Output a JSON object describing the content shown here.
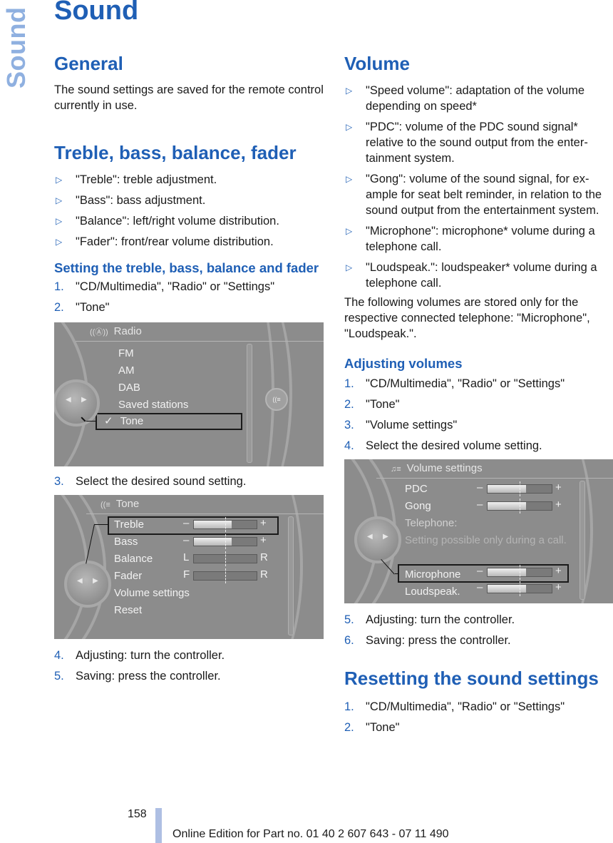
{
  "side_tab": "Sound",
  "page_title": "Sound",
  "left": {
    "general": {
      "heading": "General",
      "text": "The sound settings are saved for the remote control currently in use."
    },
    "treble": {
      "heading": "Treble, bass, balance, fader",
      "bullets": [
        "\"Treble\": treble adjustment.",
        "\"Bass\": bass adjustment.",
        "\"Balance\": left/right volume distribution.",
        "\"Fader\": front/rear volume distribution."
      ]
    },
    "setting": {
      "heading": "Setting the treble, bass, balance and fader",
      "steps_a": [
        {
          "num": "1.",
          "text": "\"CD/Multimedia\", \"Radio\" or \"Settings\""
        },
        {
          "num": "2.",
          "text": "\"Tone\""
        }
      ],
      "step_3": {
        "num": "3.",
        "text": "Select the desired sound setting."
      },
      "steps_b": [
        {
          "num": "4.",
          "text": "Adjusting: turn the controller."
        },
        {
          "num": "5.",
          "text": "Saving: press the controller."
        }
      ]
    }
  },
  "radio_screen": {
    "title": "Radio",
    "items": [
      "FM",
      "AM",
      "DAB",
      "Saved stations",
      "Tone"
    ],
    "selected": "Tone",
    "check": "✓"
  },
  "tone_screen": {
    "title": "Tone",
    "rows": [
      {
        "label": "Treble",
        "left": "–",
        "right": "+",
        "value": 0.6
      },
      {
        "label": "Bass",
        "left": "–",
        "right": "+",
        "value": 0.6
      },
      {
        "label": "Balance",
        "left": "L",
        "right": "R",
        "value": 0.5
      },
      {
        "label": "Fader",
        "left": "F",
        "right": "R",
        "value": 0.5
      }
    ],
    "extra_items": [
      "Volume settings",
      "Reset"
    ],
    "selected": "Treble"
  },
  "right": {
    "volume": {
      "heading": "Volume",
      "bullets": [
        "\"Speed volume\": adaptation of the volume depending on speed*",
        "\"PDC\": volume of the PDC sound signal* relative to the sound output from the enter-tainment system.",
        "\"Gong\": volume of the sound signal, for ex-ample for seat belt reminder, in relation to the sound output from the entertainment system.",
        "\"Microphone\": microphone* volume during a telephone call.",
        "\"Loudspeak.\": loudspeaker* volume during a telephone call."
      ],
      "note": "The following volumes are stored only for the respective connected telephone: \"Microphone\", \"Loudspeak.\"."
    },
    "adjusting": {
      "heading": "Adjusting volumes",
      "steps_a": [
        {
          "num": "1.",
          "text": "\"CD/Multimedia\", \"Radio\" or \"Settings\""
        },
        {
          "num": "2.",
          "text": "\"Tone\""
        },
        {
          "num": "3.",
          "text": "\"Volume settings\""
        },
        {
          "num": "4.",
          "text": "Select the desired volume setting."
        }
      ],
      "steps_b": [
        {
          "num": "5.",
          "text": "Adjusting: turn the controller."
        },
        {
          "num": "6.",
          "text": "Saving: press the controller."
        }
      ]
    },
    "resetting": {
      "heading": "Resetting the sound settings",
      "steps": [
        {
          "num": "1.",
          "text": "\"CD/Multimedia\", \"Radio\" or \"Settings\""
        },
        {
          "num": "2.",
          "text": "\"Tone\""
        }
      ]
    }
  },
  "volume_screen": {
    "title": "Volume settings",
    "rows": [
      {
        "label": "PDC",
        "value": 0.6
      },
      {
        "label": "Gong",
        "value": 0.6
      }
    ],
    "telephone_label": "Telephone:",
    "telephone_note": "Setting possible only during a call.",
    "phone_rows": [
      {
        "label": "Microphone",
        "value": 0.6
      },
      {
        "label": "Loudspeak.",
        "value": 0.6
      }
    ],
    "minus": "–",
    "plus": "+",
    "selected": "Microphone"
  },
  "footer": {
    "page_number": "158",
    "edition": "Online Edition for Part no. 01 40 2 607 643 - 07 11 490"
  }
}
